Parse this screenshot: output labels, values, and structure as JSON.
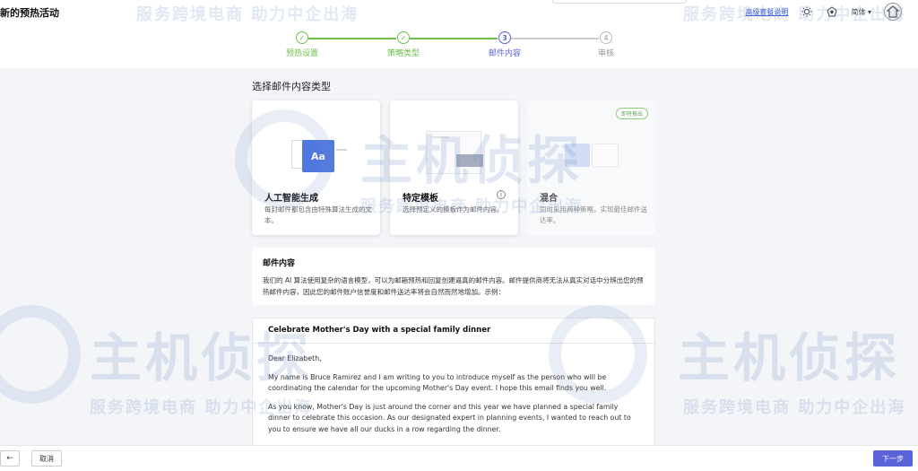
{
  "header": {
    "title": "新的预热活动",
    "link_text": "高级套餐说明",
    "lang_label": "简体",
    "icons": [
      "theme-icon",
      "gem-icon",
      "avatar-icon"
    ]
  },
  "steps": [
    {
      "number": "✓",
      "label": "预热设置",
      "state": "done"
    },
    {
      "number": "✓",
      "label": "策略类型",
      "state": "done"
    },
    {
      "number": "3",
      "label": "邮件内容",
      "state": "active"
    },
    {
      "number": "4",
      "label": "审核",
      "state": "todo"
    }
  ],
  "section_title": "选择邮件内容类型",
  "cards": [
    {
      "title": "人工智能生成",
      "desc": "每封邮件都包含由特殊算法生成的文本。",
      "illus_text": "Aa"
    },
    {
      "title": "特定模板",
      "desc": "选择预定义的模板作为邮件内容。"
    },
    {
      "title": "混合",
      "desc": "同时采用两种策略，实现最佳邮件送达率。",
      "badge": "即将推出"
    }
  ],
  "content_info": {
    "heading": "邮件内容",
    "text": "我们的 AI 算法使用复杂的语言模型，可以为邮箱预热和回复创建逼真的邮件内容。邮件提供商将无法从真实对话中分辨出您的预热邮件内容，因此您的邮件账户信誉度和邮件送达率将会自然而然地增加。示例："
  },
  "email": {
    "subject": "Celebrate Mother's Day with a special family dinner",
    "paragraphs": [
      "Dear Elizabeth,",
      "My name is Bruce Ramirez and I am writing to you to introduce myself as the person who will be coordinating the calendar for the upcoming Mother's Day event. I hope this email finds you well.",
      "As you know, Mother's Day is just around the corner and this year we have planned a special family dinner to celebrate this occasion. As our designated expert in planning events, I wanted to reach out to you to ensure we have all our ducks in a row regarding the dinner."
    ]
  },
  "footer": {
    "back_symbol": "←",
    "cancel_label": "取消",
    "next_label": "下一步"
  },
  "watermark": {
    "line1": "服务跨境电商 助力中企出海",
    "brand": "主机侦探"
  },
  "colors": {
    "accent": "#5a62d8",
    "done": "#6cc04a"
  }
}
